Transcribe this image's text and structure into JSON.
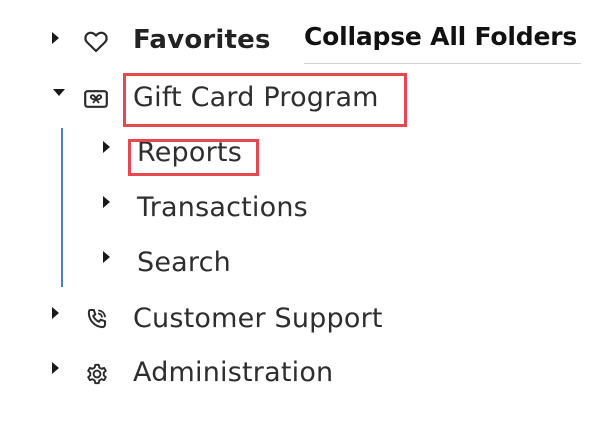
{
  "header": {
    "collapse_label": "Collapse All Folders"
  },
  "tree": {
    "favorites": {
      "label": "Favorites",
      "icon": "heart-icon",
      "expanded": false
    },
    "gift_card_program": {
      "label": "Gift Card Program",
      "icon": "gift-card-icon",
      "expanded": true,
      "children": [
        {
          "label": "Reports",
          "expanded": false
        },
        {
          "label": "Transactions",
          "expanded": false
        },
        {
          "label": "Search",
          "expanded": false
        }
      ]
    },
    "customer_support": {
      "label": "Customer Support",
      "icon": "phone-icon",
      "expanded": false
    },
    "administration": {
      "label": "Administration",
      "icon": "gear-icon",
      "expanded": false
    }
  },
  "colors": {
    "highlight": "#e5484d",
    "tree_line": "#4a7fd0"
  }
}
